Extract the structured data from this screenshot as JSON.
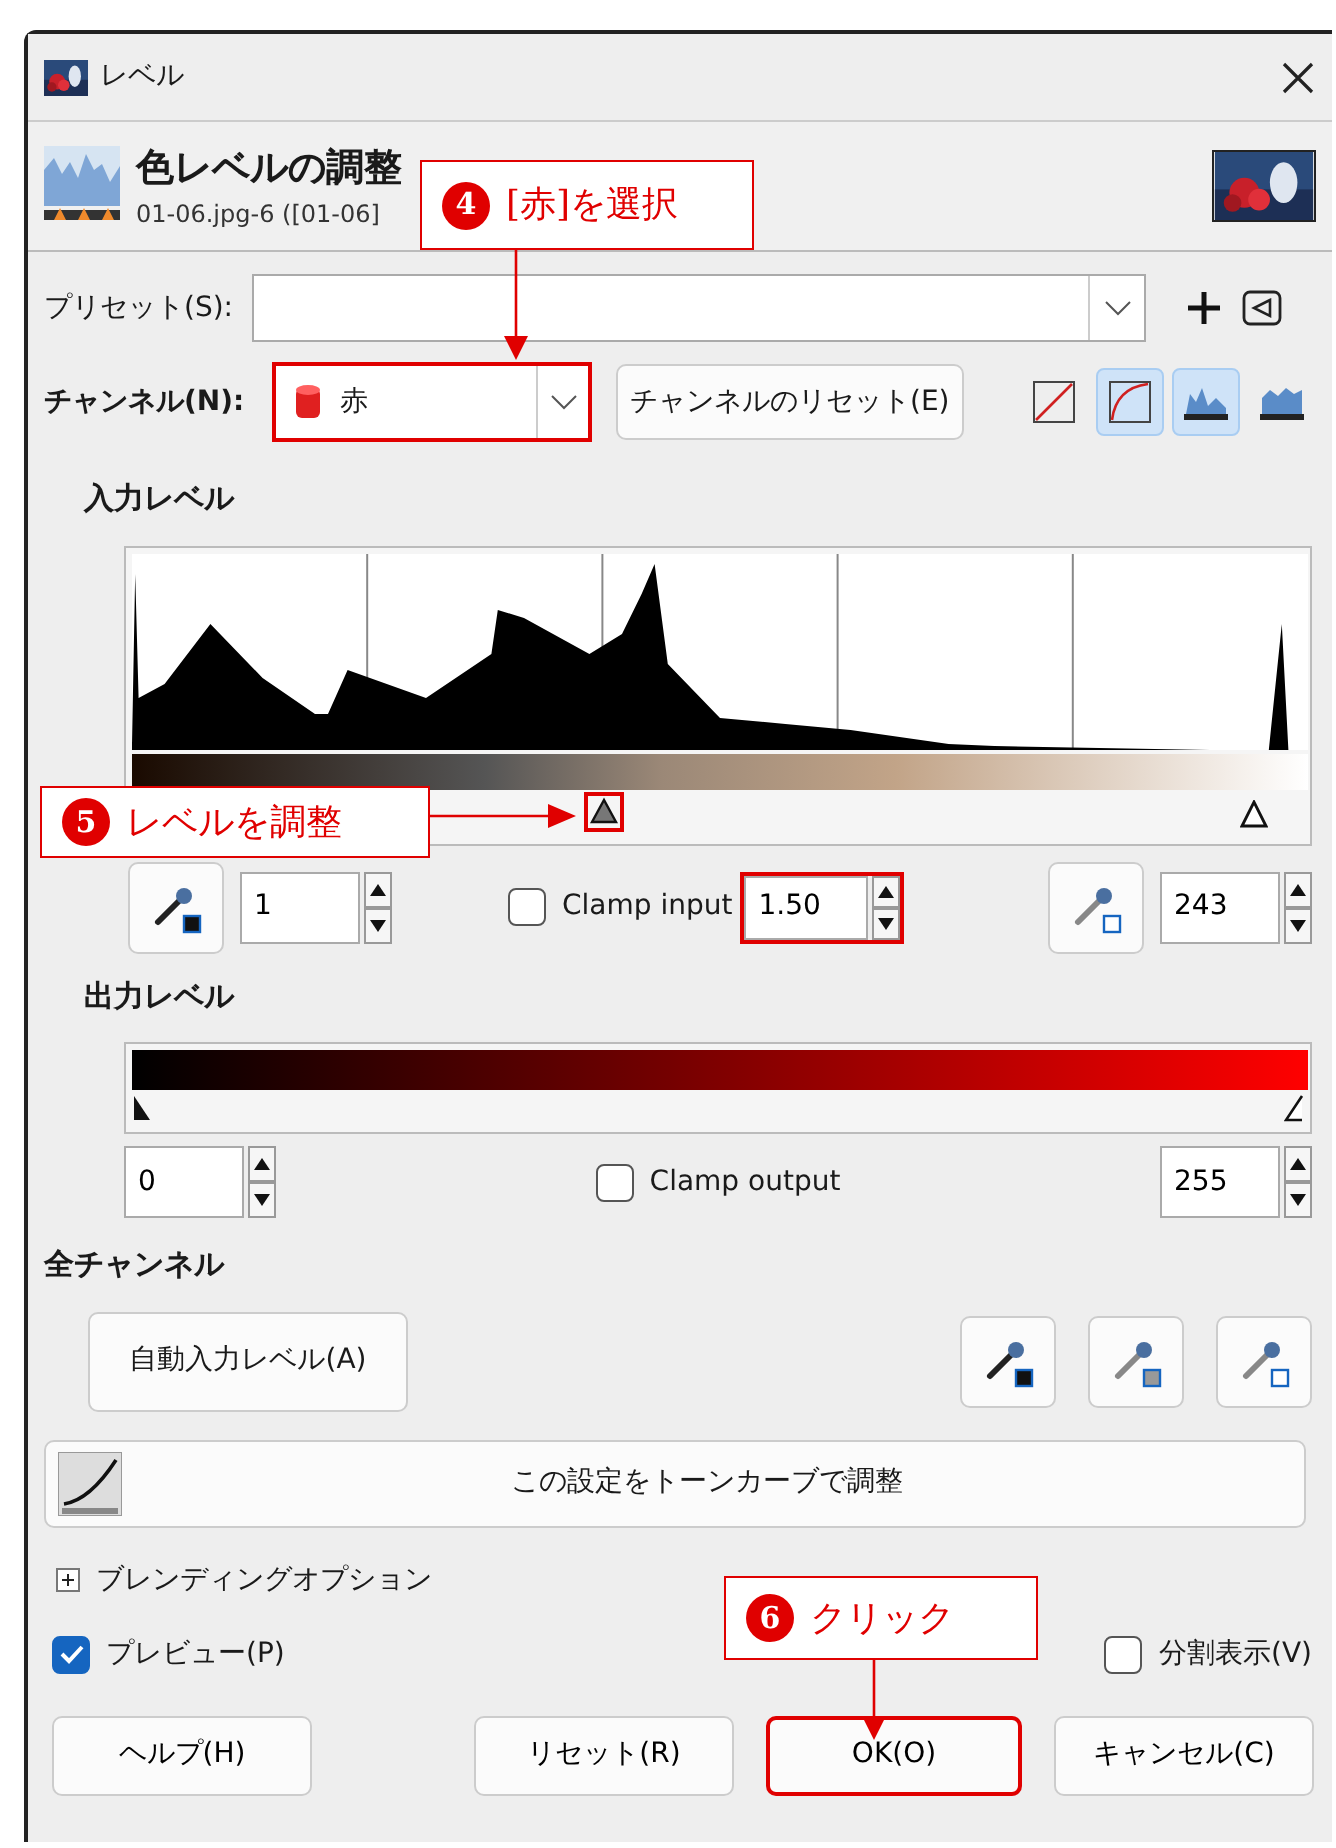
{
  "window": {
    "title": "レベル"
  },
  "header": {
    "title": "色レベルの調整",
    "subtitle": "01-06.jpg-6 ([01-06]"
  },
  "preset": {
    "label": "プリセット(S):"
  },
  "channel": {
    "label": "チャンネル(N):",
    "value": "赤",
    "highlighted": true,
    "reset_button": {
      "label": "チャンネルのリセット(E)"
    }
  },
  "curve_type_toggles": [
    {
      "kind": "linear",
      "selected": false
    },
    {
      "kind": "log",
      "selected": true
    }
  ],
  "histogram_toggles": [
    {
      "kind": "linear",
      "selected": true
    },
    {
      "kind": "log",
      "selected": false
    }
  ],
  "input_levels": {
    "heading": "入力レベル",
    "gamma_marker": {
      "level": 0.39,
      "highlighted": true
    },
    "high_marker": {
      "level": 0.955
    },
    "low": "1",
    "clamp": {
      "label": "Clamp input",
      "checked": false
    },
    "gamma": {
      "value": "1.50",
      "highlighted": true
    },
    "high": "243"
  },
  "output_levels": {
    "heading": "出力レベル",
    "low_marker": {
      "level": 0
    },
    "high_marker": {
      "level": 1
    },
    "low": "0",
    "clamp": {
      "label": "Clamp output",
      "checked": false
    },
    "high": "255"
  },
  "all_channels": {
    "heading": "全チャンネル",
    "auto_button": {
      "label": "自動入力レベル(A)"
    }
  },
  "curves_button": {
    "label": "この設定をトーンカーブで調整"
  },
  "blending": {
    "label": "ブレンディングオプション",
    "expanded": false
  },
  "preview": {
    "label": "プレビュー(P)",
    "checked": true
  },
  "split_view": {
    "label": "分割表示(V)",
    "checked": false
  },
  "buttons": [
    {
      "label": "ヘルプ(H)",
      "highlighted": false
    },
    {
      "label": "リセット(R)",
      "highlighted": false
    },
    {
      "label": "OK(O)",
      "highlighted": true
    },
    {
      "label": "キャンセル(C)",
      "highlighted": false
    }
  ],
  "annotations": [
    {
      "number": "4",
      "text": "[赤]を選択"
    },
    {
      "number": "5",
      "text": "レベルを調整"
    },
    {
      "number": "6",
      "text": "クリック"
    }
  ]
}
